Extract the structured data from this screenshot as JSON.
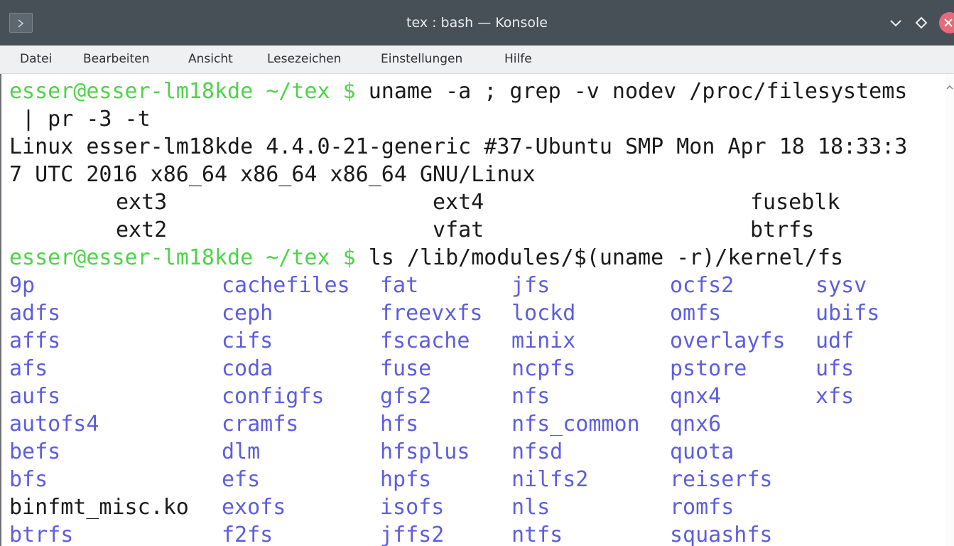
{
  "window": {
    "title": "tex : bash — Konsole",
    "icons": {
      "app": "terminal-prompt-icon",
      "minimize": "chevron-down-icon",
      "maximize": "diamond-icon",
      "close": "close-icon"
    },
    "colors": {
      "titlebar": "#475057",
      "close_button": "#e86a78",
      "prompt": "#4fd34a",
      "directory": "#5d5de0",
      "text": "#1a1a1a"
    }
  },
  "menubar": {
    "items": [
      "Datei",
      "Bearbeiten",
      "Ansicht",
      "Lesezeichen",
      "Einstellungen",
      "Hilfe"
    ]
  },
  "terminal": {
    "line1": {
      "prompt": "esser@esser-lm18kde ~/tex $",
      "command": " uname -a ; grep -v nodev /proc/filesystems"
    },
    "line2": " | pr -3 -t",
    "line3": "Linux esser-lm18kde 4.4.0-21-generic #37-Ubuntu SMP Mon Apr 18 18:33:3",
    "line4": "7 UTC 2016 x86_64 x86_64 x86_64 GNU/Linux",
    "filesystems": [
      [
        "ext3",
        "ext4",
        "fuseblk"
      ],
      [
        "ext2",
        "vfat",
        "btrfs"
      ]
    ],
    "line7": {
      "prompt": "esser@esser-lm18kde ~/tex $",
      "command": " ls /lib/modules/$(uname -r)/kernel/fs"
    },
    "listing": [
      [
        "9p",
        "cachefiles",
        "fat",
        "jfs",
        "ocfs2",
        "sysv"
      ],
      [
        "adfs",
        "ceph",
        "freevxfs",
        "lockd",
        "omfs",
        "ubifs"
      ],
      [
        "affs",
        "cifs",
        "fscache",
        "minix",
        "overlayfs",
        "udf"
      ],
      [
        "afs",
        "coda",
        "fuse",
        "ncpfs",
        "pstore",
        "ufs"
      ],
      [
        "aufs",
        "configfs",
        "gfs2",
        "nfs",
        "qnx4",
        "xfs"
      ],
      [
        "autofs4",
        "cramfs",
        "hfs",
        "nfs_common",
        "qnx6",
        ""
      ],
      [
        "befs",
        "dlm",
        "hfsplus",
        "nfsd",
        "quota",
        ""
      ],
      [
        "bfs",
        "efs",
        "hpfs",
        "nilfs2",
        "reiserfs",
        ""
      ],
      [
        "binfmt_misc.ko",
        "exofs",
        "isofs",
        "nls",
        "romfs",
        ""
      ],
      [
        "btrfs",
        "f2fs",
        "jffs2",
        "ntfs",
        "squashfs",
        ""
      ]
    ],
    "plain_files": [
      "binfmt_misc.ko"
    ]
  }
}
